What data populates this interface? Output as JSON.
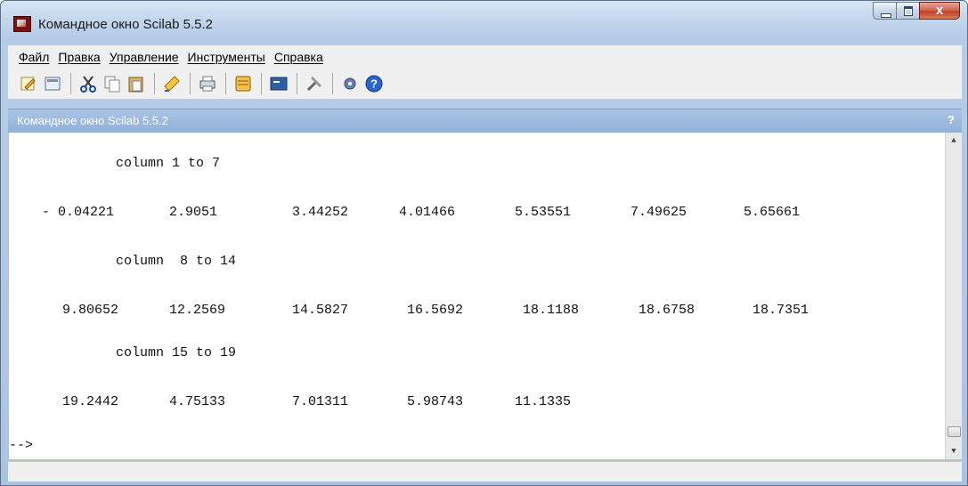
{
  "window": {
    "title": "Командное окно Scilab 5.5.2",
    "close_label": "x"
  },
  "menu": {
    "items": [
      "Файл",
      "Правка",
      "Управление",
      "Инструменты",
      "Справка"
    ]
  },
  "toolbar": {
    "icons": [
      "new-script-icon",
      "open-icon",
      "cut-icon",
      "copy-icon",
      "paste-icon",
      "clear-console-icon",
      "print-icon",
      "variable-browser-icon",
      "console-icon",
      "preferences-icon",
      "modules-icon",
      "help-icon"
    ]
  },
  "panel": {
    "title": "Командное окно Scilab 5.5.2",
    "help_label": "?"
  },
  "console": {
    "header1": "column 1 to 7",
    "row1": [
      "- 0.04221",
      "2.9051",
      "3.44252",
      "4.01466",
      "5.53551",
      "7.49625",
      "5.65661"
    ],
    "header2": "column  8 to 14",
    "row2": [
      "9.80652",
      "12.2569",
      "14.5827",
      "16.5692",
      "18.1188",
      "18.6758",
      "18.7351"
    ],
    "header3": "column 15 to 19",
    "row3": [
      "19.2442",
      "4.75133",
      "7.01311",
      "5.98743",
      "11.1335"
    ],
    "prompt": "-->"
  },
  "colors": {
    "titlebar": "#c2d6ec",
    "panel_header": "#92b1d9",
    "close_button": "#c04129"
  }
}
